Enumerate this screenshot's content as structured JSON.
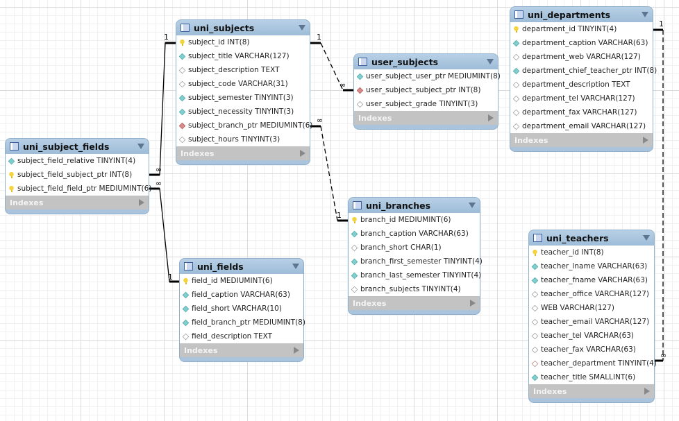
{
  "tables": [
    {
      "id": "uni_subject_fields",
      "name": "uni_subject_fields",
      "indexes_label": "Indexes",
      "columns": [
        {
          "text": "subject_field_relative TINYINT(4)",
          "icon": "nn"
        },
        {
          "text": "subject_field_subject_ptr INT(8)",
          "icon": "key"
        },
        {
          "text": "subject_field_field_ptr MEDIUMINT(6)",
          "icon": "key"
        }
      ]
    },
    {
      "id": "uni_subjects",
      "name": "uni_subjects",
      "indexes_label": "Indexes",
      "columns": [
        {
          "text": "subject_id INT(8)",
          "icon": "key"
        },
        {
          "text": "subject_title VARCHAR(127)",
          "icon": "nn"
        },
        {
          "text": "subject_description TEXT",
          "icon": "null"
        },
        {
          "text": "subject_code VARCHAR(31)",
          "icon": "null"
        },
        {
          "text": "subject_semester TINYINT(3)",
          "icon": "nn"
        },
        {
          "text": "subject_necessity TINYINT(3)",
          "icon": "nn"
        },
        {
          "text": "subject_branch_ptr MEDIUMINT(6)",
          "icon": "fk"
        },
        {
          "text": "subject_hours TINYINT(3)",
          "icon": "null"
        }
      ]
    },
    {
      "id": "user_subjects",
      "name": "user_subjects",
      "indexes_label": "Indexes",
      "columns": [
        {
          "text": "user_subject_user_ptr MEDIUMINT(8)",
          "icon": "nn"
        },
        {
          "text": "user_subject_subject_ptr INT(8)",
          "icon": "fk"
        },
        {
          "text": "user_subject_grade TINYINT(3)",
          "icon": "null"
        }
      ]
    },
    {
      "id": "uni_departments",
      "name": "uni_departments",
      "indexes_label": "Indexes",
      "columns": [
        {
          "text": "department_id TINYINT(4)",
          "icon": "key"
        },
        {
          "text": "department_caption VARCHAR(63)",
          "icon": "nn"
        },
        {
          "text": "department_web VARCHAR(127)",
          "icon": "null"
        },
        {
          "text": "department_chief_teacher_ptr INT(8)",
          "icon": "nn"
        },
        {
          "text": "department_description TEXT",
          "icon": "null"
        },
        {
          "text": "department_tel VARCHAR(127)",
          "icon": "null"
        },
        {
          "text": "department_fax VARCHAR(127)",
          "icon": "null"
        },
        {
          "text": "department_email VARCHAR(127)",
          "icon": "null"
        }
      ]
    },
    {
      "id": "uni_fields",
      "name": "uni_fields",
      "indexes_label": "Indexes",
      "columns": [
        {
          "text": "field_id MEDIUMINT(6)",
          "icon": "key"
        },
        {
          "text": "field_caption VARCHAR(63)",
          "icon": "nn"
        },
        {
          "text": "field_short VARCHAR(10)",
          "icon": "nn"
        },
        {
          "text": "field_branch_ptr MEDIUMINT(8)",
          "icon": "nn"
        },
        {
          "text": "field_description TEXT",
          "icon": "null"
        }
      ]
    },
    {
      "id": "uni_branches",
      "name": "uni_branches",
      "indexes_label": "Indexes",
      "columns": [
        {
          "text": "branch_id MEDIUMINT(6)",
          "icon": "key"
        },
        {
          "text": "branch_caption VARCHAR(63)",
          "icon": "nn"
        },
        {
          "text": "branch_short CHAR(1)",
          "icon": "null"
        },
        {
          "text": "branch_first_semester TINYINT(4)",
          "icon": "nn"
        },
        {
          "text": "branch_last_semester TINYINT(4)",
          "icon": "nn"
        },
        {
          "text": "branch_subjects TINYINT(4)",
          "icon": "null"
        }
      ]
    },
    {
      "id": "uni_teachers",
      "name": "uni_teachers",
      "indexes_label": "Indexes",
      "columns": [
        {
          "text": "teacher_id INT(8)",
          "icon": "key"
        },
        {
          "text": "teacher_lname VARCHAR(63)",
          "icon": "nn"
        },
        {
          "text": "teacher_fname VARCHAR(63)",
          "icon": "nn"
        },
        {
          "text": "teacher_office VARCHAR(127)",
          "icon": "null"
        },
        {
          "text": "WEB VARCHAR(127)",
          "icon": "null"
        },
        {
          "text": "teacher_email VARCHAR(127)",
          "icon": "null"
        },
        {
          "text": "teacher_tel VARCHAR(63)",
          "icon": "null"
        },
        {
          "text": "teacher_fax VARCHAR(63)",
          "icon": "null"
        },
        {
          "text": "teacher_department TINYINT(4)",
          "icon": "fknull"
        },
        {
          "text": "teacher_title SMALLINT(6)",
          "icon": "nn"
        }
      ]
    }
  ],
  "relationships": [
    {
      "from": "uni_subject_fields.subject_field_subject_ptr",
      "to": "uni_subjects.subject_id",
      "many": "∞",
      "one": "1",
      "style": "solid"
    },
    {
      "from": "uni_subject_fields.subject_field_field_ptr",
      "to": "uni_fields.field_id",
      "many": "∞",
      "one": "1",
      "style": "solid"
    },
    {
      "from": "user_subjects.user_subject_subject_ptr",
      "to": "uni_subjects.subject_id",
      "many": "∞",
      "one": "1",
      "style": "dashed"
    },
    {
      "from": "uni_subjects.subject_branch_ptr",
      "to": "uni_branches.branch_id",
      "many": "∞",
      "one": "1",
      "style": "dashed"
    },
    {
      "from": "uni_teachers.teacher_department",
      "to": "uni_departments.department_id",
      "many": "∞",
      "one": "1",
      "style": "dashed"
    }
  ]
}
